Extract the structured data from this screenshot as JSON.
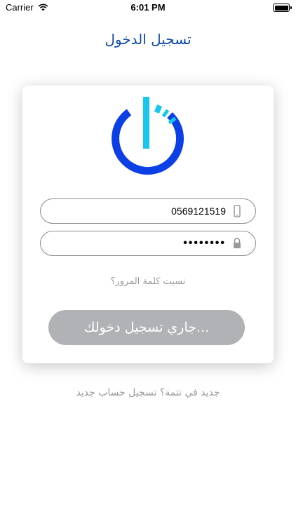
{
  "status_bar": {
    "carrier": "Carrier",
    "time": "6:01 PM"
  },
  "page_title": "تسجيل الدخول",
  "form": {
    "phone_value": "0569121519",
    "password_value": "••••••••",
    "forgot_password": "نسيت كلمة المرور؟",
    "login_button": "جاري تسجيل دخولك..."
  },
  "signup_text": "جديد في تتمة؟ تسجيل حساب جديد",
  "colors": {
    "title": "#0e4aa8",
    "button": "#b0b2b6",
    "logo_blue": "#0d3fe6",
    "logo_cyan": "#17c7ee"
  },
  "icons": [
    "wifi-icon",
    "battery-icon",
    "power-logo-icon",
    "phone-icon",
    "lock-icon"
  ]
}
